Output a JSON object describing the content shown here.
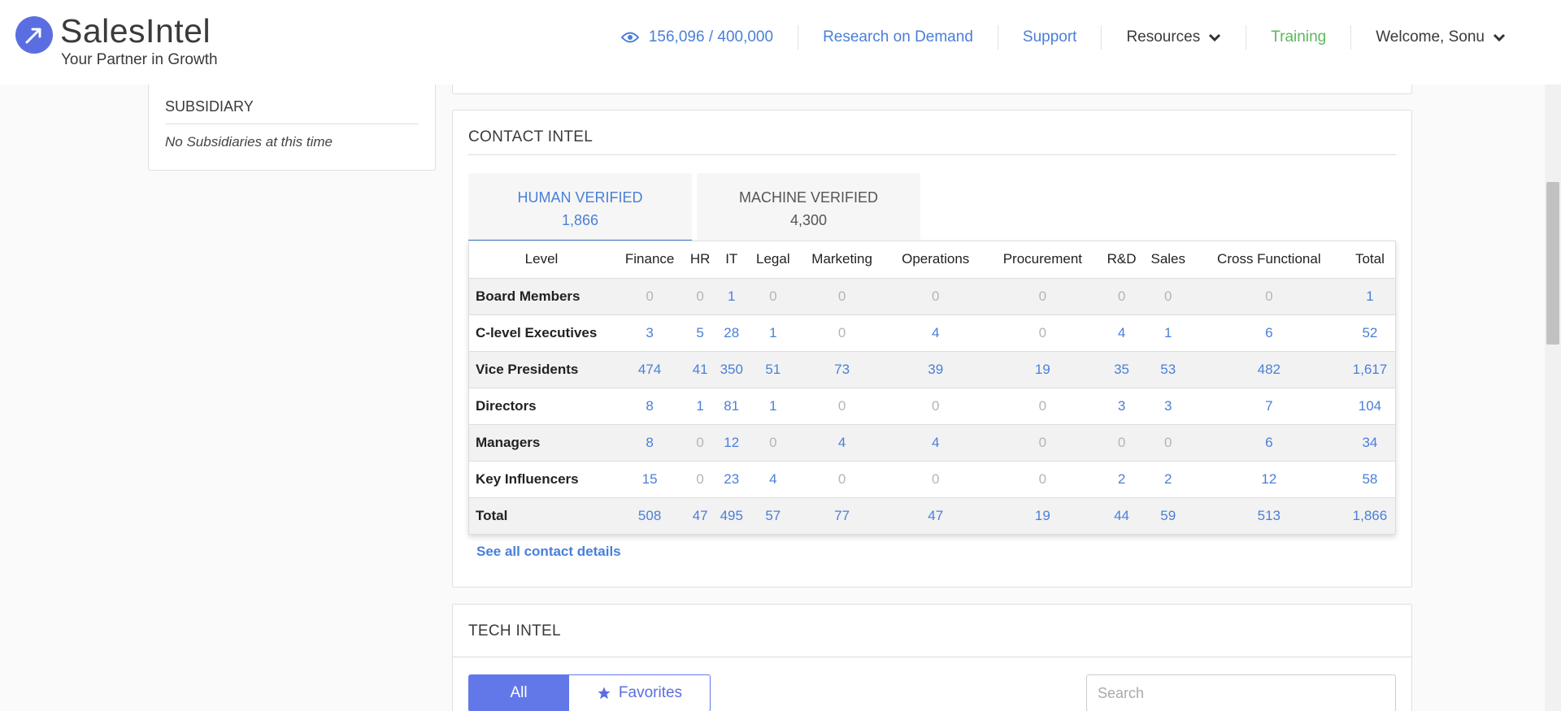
{
  "header": {
    "brand": "SalesIntel",
    "tagline": "Your Partner in Growth",
    "credits": "156,096 / 400,000",
    "research": "Research on Demand",
    "support": "Support",
    "resources": "Resources",
    "training": "Training",
    "welcome": "Welcome, Sonu"
  },
  "subsidiary": {
    "title": "SUBSIDIARY",
    "empty": "No Subsidiaries at this time"
  },
  "contact": {
    "title": "CONTACT INTEL",
    "tab_human_label": "HUMAN VERIFIED",
    "tab_human_count": "1,866",
    "tab_machine_label": "MACHINE VERIFIED",
    "tab_machine_count": "4,300",
    "columns": [
      "Level",
      "Finance",
      "HR",
      "IT",
      "Legal",
      "Marketing",
      "Operations",
      "Procurement",
      "R&D",
      "Sales",
      "Cross Functional",
      "Total"
    ],
    "rows": [
      {
        "label": "Board Members",
        "values": [
          "0",
          "0",
          "1",
          "0",
          "0",
          "0",
          "0",
          "0",
          "0",
          "0",
          "1"
        ]
      },
      {
        "label": "C-level Executives",
        "values": [
          "3",
          "5",
          "28",
          "1",
          "0",
          "4",
          "0",
          "4",
          "1",
          "6",
          "52"
        ]
      },
      {
        "label": "Vice Presidents",
        "values": [
          "474",
          "41",
          "350",
          "51",
          "73",
          "39",
          "19",
          "35",
          "53",
          "482",
          "1,617"
        ]
      },
      {
        "label": "Directors",
        "values": [
          "8",
          "1",
          "81",
          "1",
          "0",
          "0",
          "0",
          "3",
          "3",
          "7",
          "104"
        ]
      },
      {
        "label": "Managers",
        "values": [
          "8",
          "0",
          "12",
          "0",
          "4",
          "4",
          "0",
          "0",
          "0",
          "6",
          "34"
        ]
      },
      {
        "label": "Key Influencers",
        "values": [
          "15",
          "0",
          "23",
          "4",
          "0",
          "0",
          "0",
          "2",
          "2",
          "12",
          "58"
        ]
      },
      {
        "label": "Total",
        "values": [
          "508",
          "47",
          "495",
          "57",
          "77",
          "47",
          "19",
          "44",
          "59",
          "513",
          "1,866"
        ]
      }
    ],
    "see_all": "See all contact details"
  },
  "tech": {
    "title": "TECH INTEL",
    "all_label": "All",
    "favorites_label": "Favorites",
    "search_placeholder": "Search"
  },
  "colors": {
    "accent": "#5b6ee1",
    "link": "#4a7fd8",
    "training": "#5cb85c"
  }
}
